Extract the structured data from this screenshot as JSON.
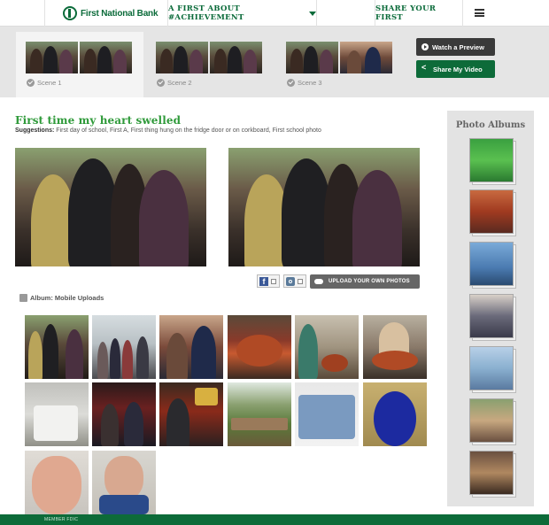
{
  "header": {
    "brand_name": "First National Bank",
    "nav_label": "A FIRST ABOUT #ACHIEVEMENT",
    "share_label": "SHARE YOUR FIRST"
  },
  "scenes": [
    {
      "label": "Scene 1",
      "active": true
    },
    {
      "label": "Scene 2",
      "active": false
    },
    {
      "label": "Scene 3",
      "active": false
    }
  ],
  "actions": {
    "preview_label": "Watch a Preview",
    "share_video_label": "Share My Video"
  },
  "main": {
    "title": "First time my heart swelled",
    "suggestions_label": "Suggestions:",
    "suggestions_text": "First day of school, First A, First thing hung on the fridge door or on corkboard, First school photo",
    "upload_label": "UPLOAD YOUR OWN PHOTOS",
    "album_label": "Album: Mobile Uploads"
  },
  "sidebar": {
    "title": "Photo Albums"
  },
  "footer": {
    "text": "MEMBER FDIC"
  },
  "colors": {
    "brand_green": "#0b6b3a",
    "title_green": "#2f9a3a",
    "facebook_blue": "#3b5998"
  }
}
